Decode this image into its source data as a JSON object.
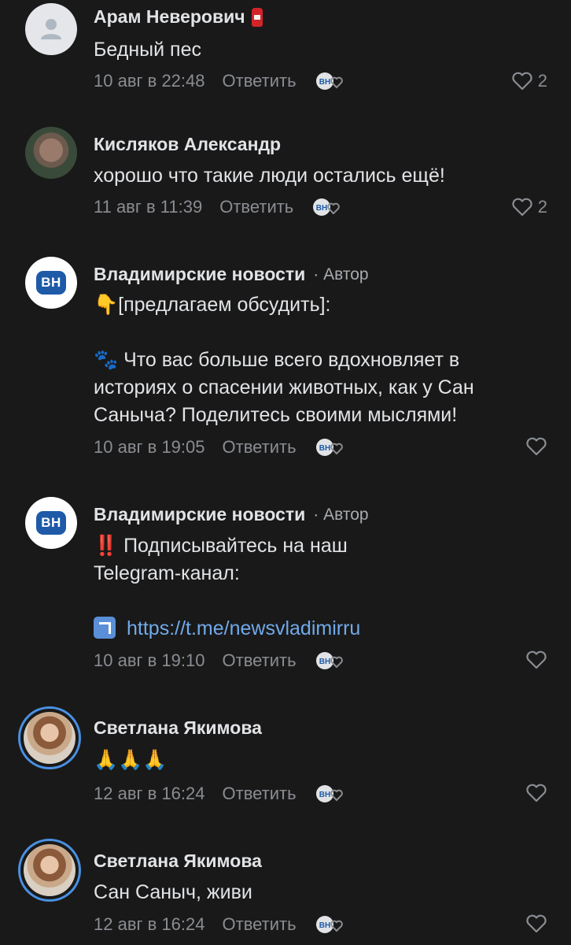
{
  "comments": [
    {
      "author": "Арам Неверович",
      "author_icon": "fire-extinguisher-emoji",
      "avatar": "placeholder-user-icon",
      "text": "Бедный пес",
      "time": "10 авг в 22:48",
      "reply": "Ответить",
      "likes": "2"
    },
    {
      "author": "Кисляков Александр",
      "avatar": "user-photo",
      "text": "хорошо  что такие люди остались ещё!",
      "time": "11 авг в 11:39",
      "reply": "Ответить",
      "likes": "2"
    },
    {
      "author": "Владимирские новости",
      "author_tag": "· Автор",
      "avatar_label": "ВН",
      "line1": "👇[предлагаем обсудить]:",
      "line2": "🐾 Что вас больше всего вдохновляет в историях о спасении животных, как у Сан Саныча? Поделитесь своими мыслями!",
      "time": "10 авг в 19:05",
      "reply": "Ответить"
    },
    {
      "author": "Владимирские новости",
      "author_tag": "· Автор",
      "avatar_label": "ВН",
      "line1": "‼️ Подписывайтесь на наш Telegram-канал:",
      "link": "https://t.me/newsvladimirru",
      "time": "10 авг в 19:10",
      "reply": "Ответить"
    },
    {
      "author": "Светлана Якимова",
      "avatar": "user-photo",
      "text": "🙏🙏🙏",
      "time": "12 авг в 16:24",
      "reply": "Ответить"
    },
    {
      "author": "Светлана Якимова",
      "avatar": "user-photo",
      "text": "Сан Саныч, живи",
      "time": "12 авг в 16:24",
      "reply": "Ответить"
    }
  ],
  "vh_like_label": "ВН",
  "colors": {
    "background": "#191919",
    "text": "#e1e3e6",
    "secondary": "#8a8d92",
    "link": "#71aaeb",
    "brand": "#1e5aa8",
    "story_ring": "#4a90e2"
  }
}
